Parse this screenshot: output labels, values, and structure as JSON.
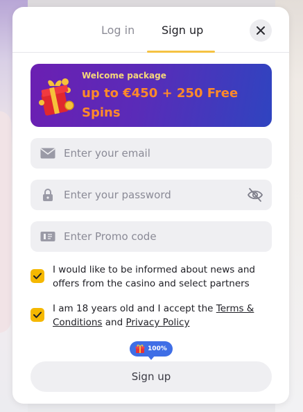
{
  "tabs": {
    "login": "Log in",
    "signup": "Sign up",
    "active": "signup"
  },
  "promo": {
    "subtitle": "Welcome package",
    "headline": "up to €450 + 250 Free Spins",
    "icon": "gift-box-icon"
  },
  "fields": {
    "email": {
      "placeholder": "Enter your email",
      "value": "",
      "icon": "envelope-icon"
    },
    "password": {
      "placeholder": "Enter your password",
      "value": "",
      "icon": "lock-icon",
      "toggle_icon": "eye-off-icon"
    },
    "promo_code": {
      "placeholder": "Enter Promo code",
      "value": "",
      "icon": "ticket-icon"
    }
  },
  "consents": {
    "news": {
      "checked": true,
      "text": "I would like to be informed about news and offers from the casino and select partners"
    },
    "age": {
      "checked": true,
      "text_before": "I am 18 years old and I accept the ",
      "terms_link": "Terms & Conditions",
      "text_and": " and ",
      "privacy_link": "Privacy Policy"
    }
  },
  "progress_badge": {
    "label": "100%",
    "progress": 1.0,
    "icon": "gift-icon"
  },
  "submit_label": "Sign up",
  "colors": {
    "accent": "#f5b800",
    "tab_underline": "#f5c242",
    "promo_headline": "#ff8a2a",
    "promo_gradient_start": "#6b1fb2",
    "promo_gradient_end": "#2f44c0",
    "badge": "#3f6ee6"
  }
}
